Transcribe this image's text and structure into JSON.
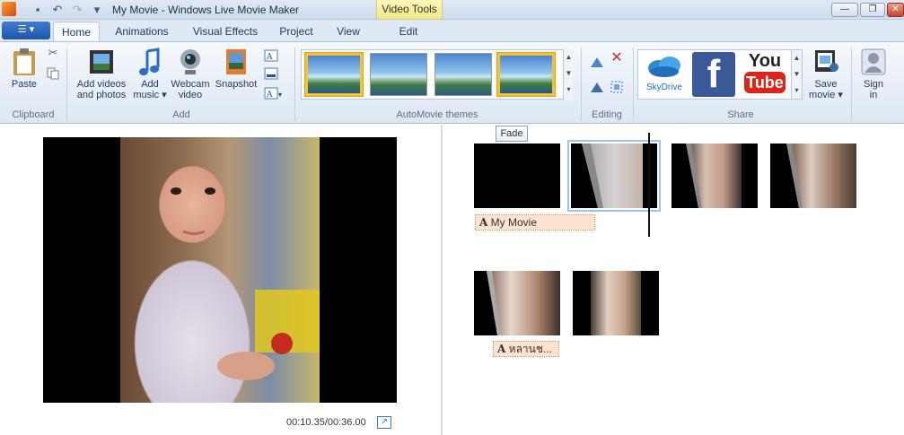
{
  "window": {
    "title": "My Movie - Windows Live Movie Maker",
    "context_tab": "Video Tools"
  },
  "tabs": [
    {
      "label": "Home"
    },
    {
      "label": "Animations"
    },
    {
      "label": "Visual Effects"
    },
    {
      "label": "Project"
    },
    {
      "label": "View"
    },
    {
      "label": "Edit"
    }
  ],
  "ribbon": {
    "clipboard": {
      "paste": "Paste",
      "group": "Clipboard"
    },
    "add": {
      "add_videos": "Add videos",
      "add_videos2": "and photos",
      "add_music": "Add",
      "add_music2": "music",
      "webcam": "Webcam",
      "webcam2": "video",
      "snapshot": "Snapshot",
      "group": "Add"
    },
    "themes": {
      "group": "AutoMovie themes"
    },
    "editing": {
      "group": "Editing"
    },
    "share": {
      "skydrive": "SkyDrive",
      "youtube": "You",
      "youtube2": "Tube",
      "save_movie": "Save",
      "save_movie2": "movie",
      "sign_in": "Sign",
      "sign_in2": "in",
      "group": "Share"
    }
  },
  "tooltip": "Fade",
  "preview": {
    "time": "00:10.35/00:36.00"
  },
  "storyboard": {
    "caption1": "My Movie",
    "caption2": "หลานช..."
  },
  "colors": {
    "accent": "#1f56a8",
    "caption_bg": "#fbe3cf",
    "selected_theme": "#f2c13d"
  }
}
